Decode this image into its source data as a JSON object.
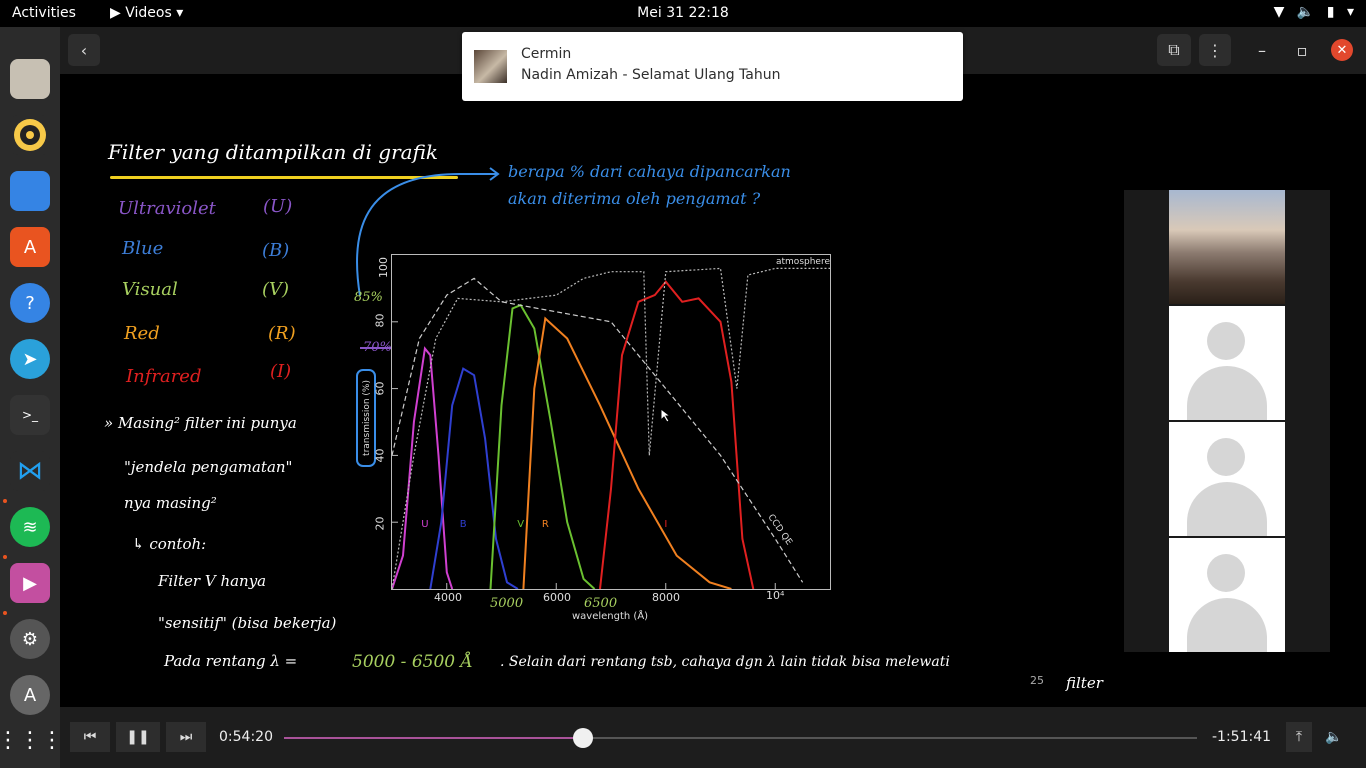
{
  "topbar": {
    "activities": "Activities",
    "app_name": "Videos",
    "clock": "Mei 31  22:18"
  },
  "notification": {
    "app": "Cermin",
    "title": "Nadin Amizah - Selamat Ulang Tahun"
  },
  "slide": {
    "heading": "Filter yang ditampilkan di grafik",
    "question_line1": "berapa % dari cahaya dipancarkan",
    "question_line2": "akan diterima oleh pengamat ?",
    "filters": [
      {
        "name": "Ultraviolet",
        "code": "(U)",
        "color": "#8a56c8"
      },
      {
        "name": "Blue",
        "code": "(B)",
        "color": "#3d7ed8"
      },
      {
        "name": "Visual",
        "code": "(V)",
        "color": "#a8d060"
      },
      {
        "name": "Red",
        "code": "(R)",
        "color": "#f0a020"
      },
      {
        "name": "Infrared",
        "code": "(I)",
        "color": "#e02020"
      }
    ],
    "note1": "» Masing² filter ini punya",
    "note2": "\"jendela pengamatan\"",
    "note3": "nya masing²",
    "note4": "↳ contoh:",
    "note5": "Filter V hanya",
    "note6": "\"sensitif\" (bisa bekerja)",
    "note7a": "Pada rentang λ =",
    "note7b": "5000 - 6500 Å",
    "note7c": ". Selain dari rentang tsb, cahaya dgn λ lain tidak bisa melewati",
    "note8": "filter",
    "mark_85": "85%",
    "mark_70": "70%",
    "mark_5000": "5000",
    "mark_6500": "6500",
    "page_number": "25",
    "ylabel_box": "transmission (%)"
  },
  "chart_data": {
    "type": "line",
    "xlabel": "wavelength (Å)",
    "ylabel": "transmission (%)",
    "xlim": [
      3000,
      11000
    ],
    "ylim": [
      0,
      100
    ],
    "xticks": [
      "4000",
      "6000",
      "8000",
      "10⁴"
    ],
    "yticks": [
      "20",
      "40",
      "60",
      "80",
      "100"
    ],
    "annotations": [
      "atmosphere",
      "CCD QE"
    ],
    "band_labels": [
      "U",
      "B",
      "V",
      "R",
      "I"
    ],
    "series": [
      {
        "name": "U",
        "color": "#d040d0",
        "x": [
          3000,
          3200,
          3400,
          3600,
          3700,
          3850,
          4000,
          4100
        ],
        "y": [
          0,
          10,
          50,
          72,
          70,
          40,
          5,
          0
        ]
      },
      {
        "name": "B",
        "color": "#2f3fd0",
        "x": [
          3700,
          3900,
          4100,
          4300,
          4500,
          4700,
          4900,
          5100,
          5300
        ],
        "y": [
          0,
          20,
          55,
          66,
          64,
          45,
          15,
          2,
          0
        ]
      },
      {
        "name": "V",
        "color": "#6ac030",
        "x": [
          4800,
          5000,
          5200,
          5350,
          5600,
          5900,
          6200,
          6500,
          6700
        ],
        "y": [
          0,
          55,
          84,
          85,
          78,
          50,
          20,
          3,
          0
        ]
      },
      {
        "name": "R",
        "color": "#f08020",
        "x": [
          5400,
          5600,
          5800,
          6200,
          6800,
          7500,
          8200,
          8800,
          9200
        ],
        "y": [
          0,
          60,
          81,
          75,
          55,
          30,
          10,
          2,
          0
        ]
      },
      {
        "name": "I",
        "color": "#e02020",
        "x": [
          6800,
          7000,
          7200,
          7500,
          7800,
          8000,
          8300,
          8600,
          9000,
          9200,
          9400,
          9600
        ],
        "y": [
          0,
          30,
          70,
          86,
          88,
          92,
          86,
          87,
          80,
          62,
          15,
          0
        ]
      },
      {
        "name": "atmosphere",
        "color": "#bbbbbb",
        "x": [
          3000,
          3400,
          3800,
          4200,
          5000,
          6000,
          6500,
          7000,
          7600,
          7700,
          8000,
          9000,
          9300,
          9500,
          10000,
          11000
        ],
        "y": [
          0,
          40,
          75,
          87,
          86,
          88,
          93,
          95,
          95,
          40,
          95,
          96,
          60,
          94,
          96,
          96
        ]
      },
      {
        "name": "CCD QE",
        "color": "#cccccc",
        "x": [
          3000,
          3500,
          4000,
          4500,
          5000,
          6000,
          7000,
          8000,
          9000,
          10000,
          10500
        ],
        "y": [
          40,
          75,
          88,
          93,
          86,
          83,
          80,
          60,
          40,
          15,
          2
        ]
      }
    ]
  },
  "player": {
    "elapsed": "0:54:20",
    "remaining": "-1:51:41",
    "progress": 0.327
  }
}
